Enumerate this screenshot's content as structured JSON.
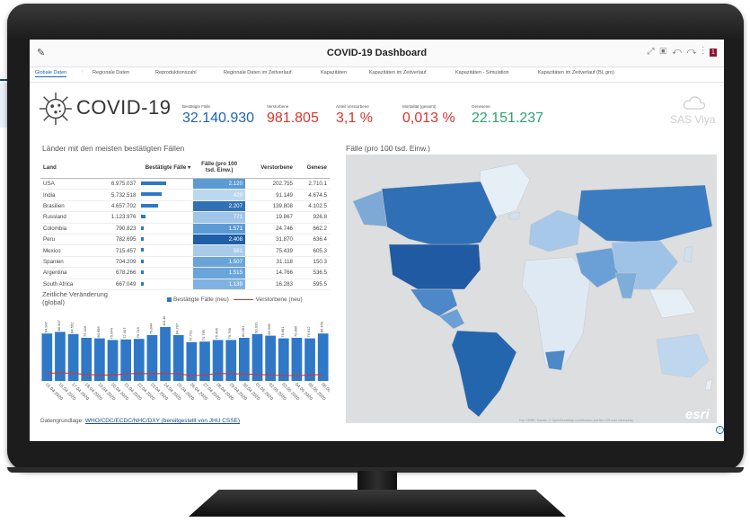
{
  "app": {
    "title": "COVID-19 Dashboard",
    "badge": "1"
  },
  "tabs": [
    {
      "label": "Globale Daten",
      "active": true
    },
    {
      "label": "Regionale Daten"
    },
    {
      "label": "Reproduktionszahl"
    },
    {
      "label": "Regionale Daten im Zeitverlauf"
    },
    {
      "label": "Kapazitäten"
    },
    {
      "label": "Kapazitäten im Zeitverlauf"
    },
    {
      "label": "Kapazitäten - Simulation"
    },
    {
      "label": "Kapazitäten im Zeitverlauf (BL gro)"
    }
  ],
  "brand": {
    "logo_text": "COVID-19",
    "sas_text": "SAS Viya"
  },
  "kpis": [
    {
      "label": "Bestätigte Fälle",
      "value": "32.140.930",
      "color": "#1a64b8"
    },
    {
      "label": "Verstorbene",
      "value": "981.805",
      "color": "#d9342b"
    },
    {
      "label": "Anteil Verstorbene",
      "value": "3,1 %",
      "color": "#d9342b"
    },
    {
      "label": "Mortalität (gesamt)",
      "value": "0,013 %",
      "color": "#d9342b"
    },
    {
      "label": "Genesene",
      "value": "22.151.237",
      "color": "#2aa56b"
    }
  ],
  "table": {
    "title": "Länder mit den meisten bestätigten Fällen",
    "headers": [
      "Land",
      "Bestätigte Fälle ▾",
      "Fälle (pro 100 tsd. Einw.)",
      "Verstorbene",
      "Genese"
    ],
    "rows": [
      {
        "land": "USA",
        "faelle": "6.975.037",
        "bar": 1.0,
        "pro100": "2.120",
        "shade": "#5b9bd5",
        "verst": "202.755",
        "gen": "2.710.1"
      },
      {
        "land": "India",
        "faelle": "5.732.518",
        "bar": 0.82,
        "pro100": "420",
        "shade": "#bcd8ef",
        "verst": "91.149",
        "gen": "4.674.5"
      },
      {
        "land": "Brasilien",
        "faelle": "4.657.702",
        "bar": 0.67,
        "pro100": "2.207",
        "shade": "#2f70b7",
        "verst": "139.808",
        "gen": "4.102.5"
      },
      {
        "land": "Russland",
        "faelle": "1.123.976",
        "bar": 0.16,
        "pro100": "771",
        "shade": "#9fc5e8",
        "verst": "19.867",
        "gen": "926.8"
      },
      {
        "land": "Colombia",
        "faelle": "790.823",
        "bar": 0.11,
        "pro100": "1.571",
        "shade": "#5b9bd5",
        "verst": "24.746",
        "gen": "662.2"
      },
      {
        "land": "Peru",
        "faelle": "782.695",
        "bar": 0.11,
        "pro100": "2.408",
        "shade": "#1f5fa8",
        "verst": "31.870",
        "gen": "636.4"
      },
      {
        "land": "Mexico",
        "faelle": "715.457",
        "bar": 0.1,
        "pro100": "561",
        "shade": "#a9cbea",
        "verst": "75.439",
        "gen": "605.3"
      },
      {
        "land": "Spanien",
        "faelle": "704.209",
        "bar": 0.1,
        "pro100": "1.507",
        "shade": "#6aa5da",
        "verst": "31.118",
        "gen": "150.3"
      },
      {
        "land": "Argentina",
        "faelle": "678.266",
        "bar": 0.1,
        "pro100": "1.515",
        "shade": "#6aa5da",
        "verst": "14.766",
        "gen": "536.5"
      },
      {
        "land": "South Africa",
        "faelle": "667.049",
        "bar": 0.1,
        "pro100": "1.139",
        "shade": "#7fb2e0",
        "verst": "16.283",
        "gen": "595.5"
      }
    ]
  },
  "timechart": {
    "title": "Zeitliche Veränderung (global)",
    "legend_bars": "Bestätigte Fälle (neu)",
    "legend_line": "Verstorbene (neu)"
  },
  "chart_data": {
    "type": "bar",
    "title": "Zeitliche Veränderung (global)",
    "categories": [
      "15.04.2020",
      "16.04.2020",
      "17.04.2020",
      "18.04.2020",
      "19.04.2020",
      "20.04.2020",
      "21.04.2020",
      "22.04.2020",
      "23.04.2020",
      "24.04.2020",
      "25.04.2020",
      "26.04.2020",
      "27.04.2020",
      "28.04.2020",
      "29.04.2020",
      "30.04.2020",
      "01.05.2020",
      "02.05.2020",
      "03.05.2020",
      "04.05.2020",
      "05.05.2020",
      "06.05.2020"
    ],
    "series": [
      {
        "name": "Bestätigte Fälle (neu)",
        "color": "#2f78c8",
        "values": [
          88,
          91,
          87,
          80,
          79,
          76,
          77,
          78,
          85,
          100,
          85,
          72,
          73,
          76,
          76,
          80,
          87,
          84,
          79,
          80,
          79,
          88
        ]
      },
      {
        "name": "Verstorbene (neu)",
        "color": "#d9342b",
        "values": [
          14,
          15,
          14,
          12,
          11,
          11,
          13,
          14,
          13,
          14,
          13,
          10,
          11,
          14,
          13,
          13,
          12,
          11,
          10,
          10,
          11,
          12
        ]
      }
    ],
    "data_labels": [
      "84.907",
      "86.907",
      "84.562",
      "75.426",
      "80.658",
      "75.644",
      "72.407",
      "76.215",
      "79.844",
      "101.808",
      "84.707",
      "72.731",
      "70.765",
      "75.496",
      "79.768",
      "80.281",
      "90.931",
      "86.508",
      "78.681",
      "79.805",
      "76.612",
      "85.450"
    ]
  },
  "map": {
    "title": "Fälle (pro 100 tsd. Einw.)",
    "esri": "esri",
    "credit": "Esri, HERE, Garmin, © OpenStreetMap contributors, and the GIS user community"
  },
  "source": {
    "label": "Datengrundlage:",
    "link": "WHO/CDC/ECDC/NHC/DXY (bereitgestellt von JHU CSSE)"
  }
}
